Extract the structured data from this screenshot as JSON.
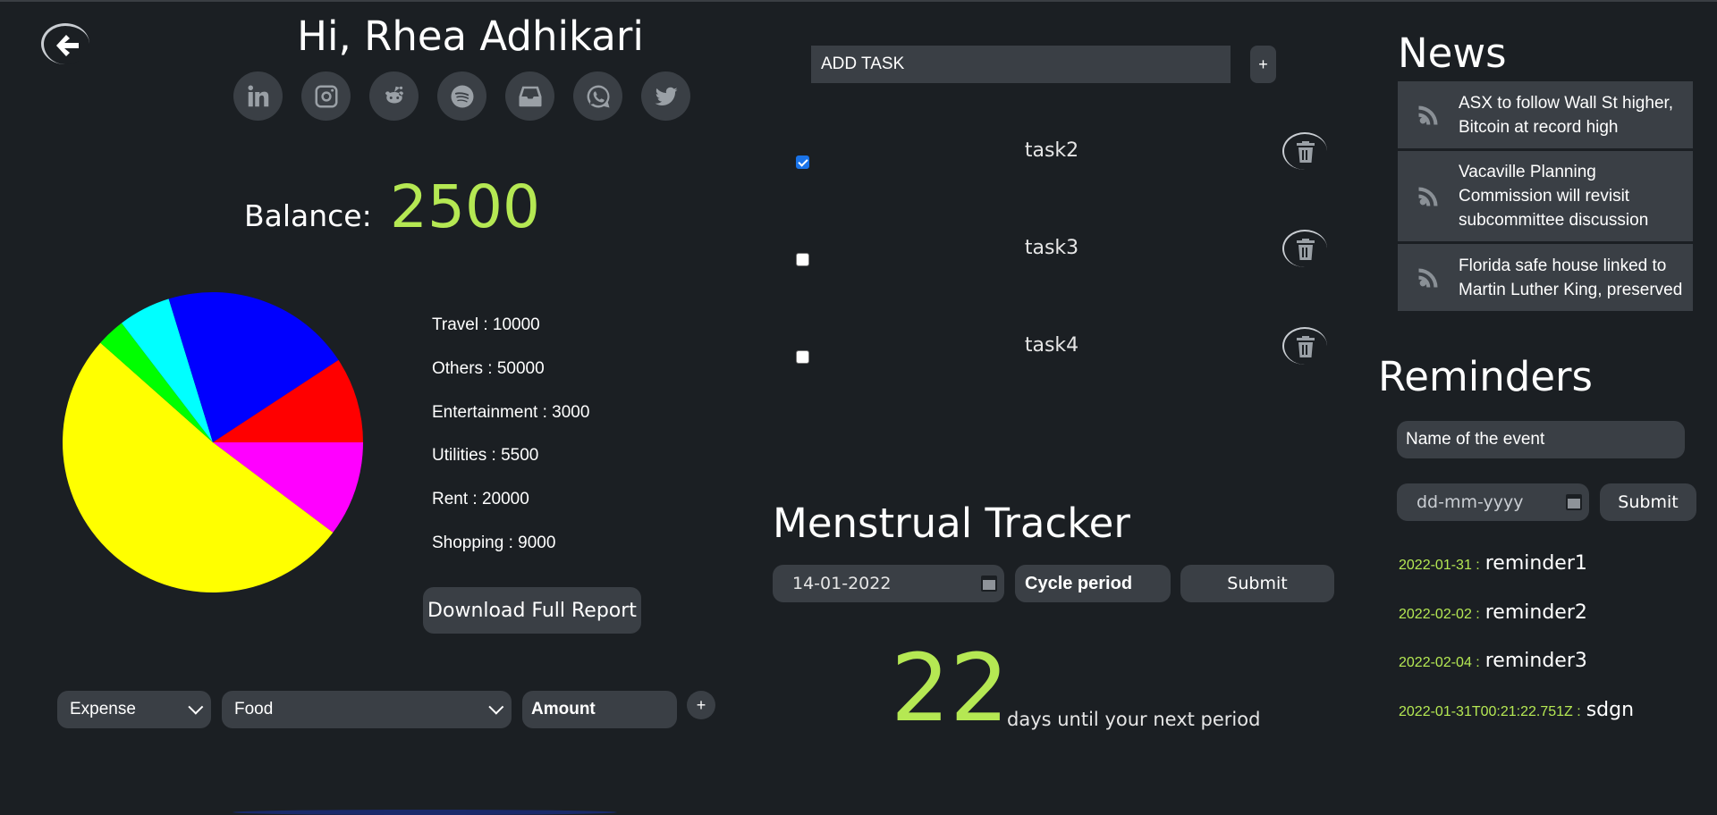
{
  "header": {
    "greeting": "Hi, Rhea Adhikari",
    "socials": [
      "linkedin-icon",
      "instagram-icon",
      "reddit-icon",
      "spotify-icon",
      "inbox-icon",
      "whatsapp-icon",
      "twitter-icon"
    ]
  },
  "balance": {
    "label": "Balance:",
    "value": "2500"
  },
  "chart_data": {
    "type": "pie",
    "slices": [
      {
        "label": "Travel",
        "value": 10000,
        "color": "#ff00ff"
      },
      {
        "label": "Others",
        "value": 50000,
        "color": "#ffff00"
      },
      {
        "label": "Entertainment",
        "value": 3000,
        "color": "#00ff00"
      },
      {
        "label": "Utilities",
        "value": 5500,
        "color": "#00ffff"
      },
      {
        "label": "Rent",
        "value": 20000,
        "color": "#0000ff"
      },
      {
        "label": "Shopping",
        "value": 9000,
        "color": "#ff0000"
      }
    ]
  },
  "legend": [
    "Travel : 10000",
    "Others : 50000",
    "Entertainment : 3000",
    "Utilities : 5500",
    "Rent : 20000",
    "Shopping : 9000"
  ],
  "download_label": "Download Full Report",
  "expense_form": {
    "type_value": "Expense",
    "category_value": "Food",
    "amount_placeholder": "Amount",
    "add_label": "+"
  },
  "tasks": {
    "input_placeholder": "ADD TASK",
    "add_label": "+",
    "items": [
      {
        "label": "task2",
        "checked": true
      },
      {
        "label": "task3",
        "checked": false
      },
      {
        "label": "task4",
        "checked": false
      }
    ]
  },
  "menstrual": {
    "title": "Menstrual Tracker",
    "date_value": "14-01-2022",
    "cycle_placeholder": "Cycle period",
    "submit_label": "Submit",
    "days": "22",
    "days_text": "days until your next period"
  },
  "news": {
    "title": "News",
    "items": [
      "ASX to follow Wall St higher, Bitcoin at record high",
      "Vacaville Planning Commission will revisit subcommittee discussion",
      "Florida safe house linked to Martin Luther King, preserved"
    ]
  },
  "reminders": {
    "title": "Reminders",
    "event_placeholder": "Name of the event",
    "date_placeholder": "dd-mm-yyyy",
    "submit_label": "Submit",
    "items": [
      {
        "date": "2022-01-31 :",
        "name": "reminder1"
      },
      {
        "date": "2022-02-02 :",
        "name": "reminder2"
      },
      {
        "date": "2022-02-04 :",
        "name": "reminder3"
      },
      {
        "date": "2022-01-31T00:21:22.751Z :",
        "name": "sdgn"
      }
    ]
  },
  "colors": {
    "accent": "#b5e853",
    "panel": "#3a3f45",
    "background": "#1b1f23"
  }
}
